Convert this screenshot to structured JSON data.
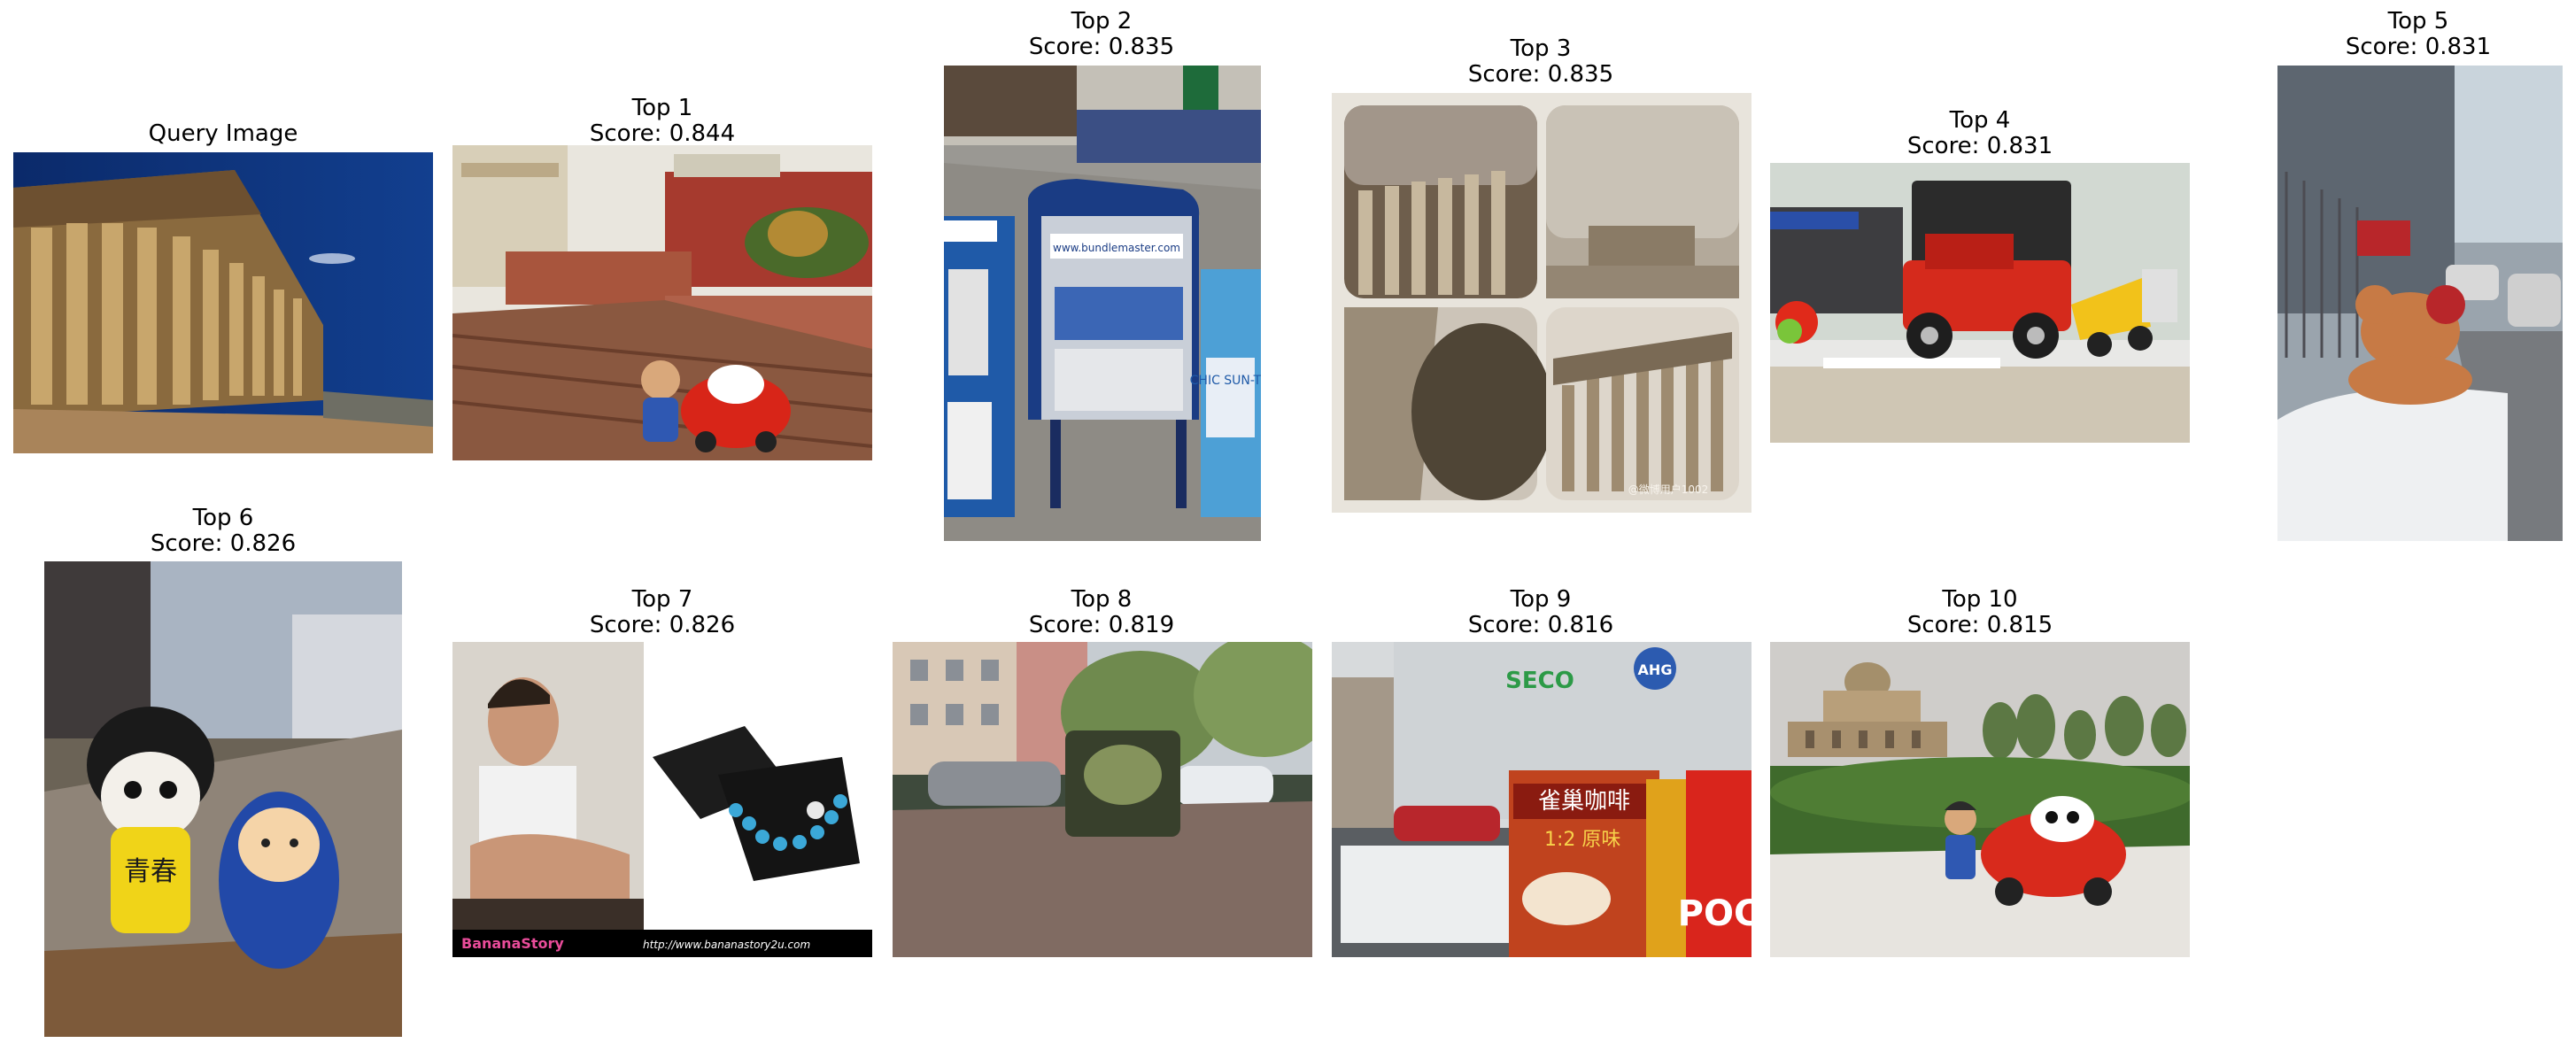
{
  "query": {
    "title": "Query Image"
  },
  "results": [
    {
      "rank": "Top 1",
      "score": "Score: 0.844"
    },
    {
      "rank": "Top 2",
      "score": "Score: 0.835"
    },
    {
      "rank": "Top 3",
      "score": "Score: 0.835",
      "watermark": "@微博用户1002"
    },
    {
      "rank": "Top 4",
      "score": "Score: 0.831"
    },
    {
      "rank": "Top 5",
      "score": "Score: 0.831"
    },
    {
      "rank": "Top 6",
      "score": "Score: 0.826",
      "sign": "青春"
    },
    {
      "rank": "Top 7",
      "score": "Score: 0.826",
      "banner_brand": "BananaStory",
      "banner_url": "http://www.bananastory2u.com"
    },
    {
      "rank": "Top 8",
      "score": "Score: 0.819"
    },
    {
      "rank": "Top 9",
      "score": "Score: 0.816",
      "sign_text": "SECO",
      "logo_text": "AHG",
      "package_text": "雀巢咖啡",
      "package_text2": "1:2 原味",
      "box_text": "POC"
    },
    {
      "rank": "Top 10",
      "score": "Score: 0.815"
    }
  ],
  "second_page": {
    "sign_text2": "www.bundlemaster.com",
    "paper_text": "CHIC SUN-TI"
  }
}
